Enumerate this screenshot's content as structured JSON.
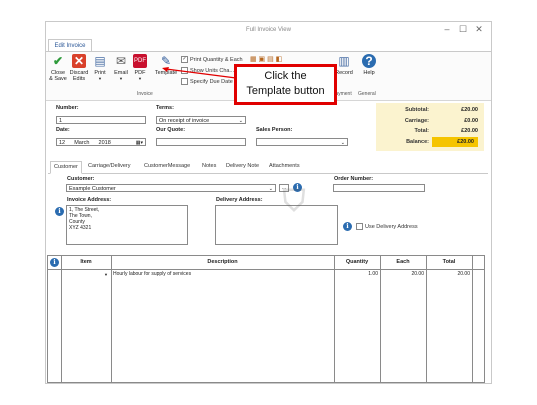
{
  "window": {
    "title": "Full Invoice View",
    "controls": {
      "minimize": "–",
      "maximize": "☐",
      "close": "✕"
    }
  },
  "ribbon": {
    "tab_label": "Edit Invoice",
    "buttons": {
      "close_save": "Close\n& Save",
      "discard_edits": "Discard\nEdits",
      "print": "Print",
      "email": "Email",
      "pdf": "PDF",
      "template": "Template",
      "record": "Record",
      "help": "Help"
    },
    "checkboxes": {
      "print_quantity": "Print Quantity & Each",
      "show_units": "Show Units Cha...",
      "specify_due_date": "Specify Due Date"
    },
    "group_labels": {
      "invoice": "Invoice",
      "payment": "Payment",
      "general": "General"
    }
  },
  "callout": {
    "text_line1": "Click the",
    "text_line2": "Template button"
  },
  "form": {
    "number_label": "Number:",
    "number_value": "1",
    "terms_label": "Terms:",
    "terms_value": "On receipt of invoice",
    "date_label": "Date:",
    "date_day": "12",
    "date_month": "March",
    "date_year": "2018",
    "our_quote_label": "Our Quote:",
    "our_quote_value": "",
    "sales_person_label": "Sales Person:",
    "sales_person_value": ""
  },
  "summary": {
    "subtotal_label": "Subtotal:",
    "subtotal_value": "£20.00",
    "carriage_label": "Carriage:",
    "carriage_value": "£0.00",
    "total_label": "Total:",
    "total_value": "£20.00",
    "balance_label": "Balance:",
    "balance_value": "£20.00",
    "balance_highlight_color": "#f5c400"
  },
  "subtabs": [
    "Customer",
    "Carriage/Delivery",
    "CustomerMessage",
    "Notes",
    "Delivery Note",
    "Attachments"
  ],
  "customer": {
    "customer_label": "Customer:",
    "customer_value": "Example Customer",
    "invoice_address_label": "Invoice Address:",
    "invoice_address_lines": [
      "1, The Street,",
      "The Town,",
      "County",
      "XYZ 4321"
    ],
    "order_number_label": "Order Number:",
    "order_number_value": "",
    "delivery_address_label": "Delivery Address:",
    "use_delivery_address_label": "Use Delivery Address"
  },
  "grid": {
    "headers": {
      "item": "Item",
      "description": "Description",
      "quantity": "Quantity",
      "each": "Each",
      "total": "Total"
    },
    "rows": [
      {
        "item": "",
        "description": "Hourly labour for supply of services",
        "quantity": "1.00",
        "each": "20.00",
        "total": "20.00"
      }
    ]
  },
  "icons": {
    "close_save": "checkmark-icon",
    "discard": "x-icon",
    "print": "printer-icon",
    "email": "envelope-icon",
    "pdf": "pdf-icon",
    "template": "template-icon",
    "record": "record-payment-icon",
    "help": "question-icon",
    "info": "info-icon"
  },
  "colors": {
    "accent": "#2b5797",
    "summary_bg": "#fbf3cf",
    "callout_border": "#e00000"
  }
}
